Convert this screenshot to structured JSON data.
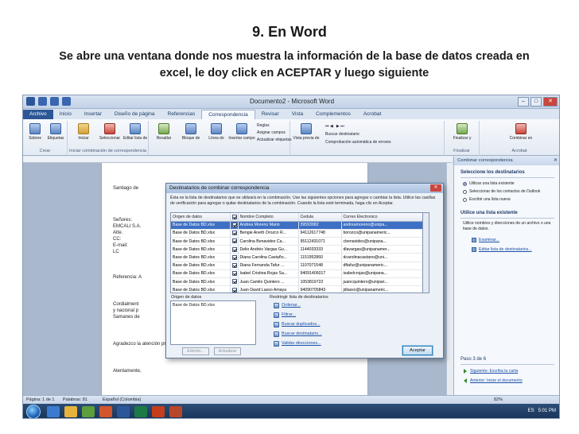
{
  "slide": {
    "title": "9. En Word",
    "subtitle": "Se abre una ventana donde nos muestra la información de la base de datos creada en excel, le doy click en ACEPTAR y luego siguiente"
  },
  "window": {
    "title": "Documento2 - Microsoft Word"
  },
  "tabs": [
    "Archivo",
    "Inicio",
    "Insertar",
    "Diseño de página",
    "Referencias",
    "Correspondencia",
    "Revisar",
    "Vista",
    "Complementos",
    "Acrobat"
  ],
  "active_tab": "Correspondencia",
  "ribbon": {
    "sobres": "Sobres",
    "etiquetas": "Etiquetas",
    "iniciar": "Iniciar combinación de correspondencia",
    "seleccionar": "Seleccionar destinatarios",
    "editar": "Editar lista de destinatarios",
    "resaltar": "Resaltar campos de combinación",
    "bloque": "Bloque de direcciones",
    "saludo": "Línea de saludo",
    "insertar_campo": "Insertar campo combinado",
    "reglas": "Reglas",
    "asignar": "Asignar campos",
    "actualizar": "Actualizar etiquetas",
    "vista_previa": "Vista previa de resultados",
    "buscar_dest": "Buscar destinatario",
    "comprobacion": "Comprobación automática de errores",
    "finalizar": "Finalizar y combinar",
    "combinar_pdf": "Combinar en archivo PDF de Adobe",
    "g_crear": "Crear",
    "g_iniciar": "Iniciar combinación de correspondencia",
    "g_finalizar": "Finalizar",
    "g_acrobat": "Acrobat"
  },
  "document": {
    "lines": [
      "Santiago de",
      "Señores:",
      "EMCALI S.A.",
      "Atte.",
      "CC:",
      "E-mail:",
      "LC",
      "Referencia: A",
      "Cordialment",
      "y nacional p",
      "Samanes de",
      "Agradezco la atención prestada.",
      "Atentamente,"
    ]
  },
  "dialog": {
    "title": "Destinatarios de combinar correspondencia",
    "description": "Ésta es la lista de destinatarios que se utilizará en la combinación. Use las siguientes opciones para agregar o cambiar la lista. Utilice las casillas de verificación para agregar o quitar destinatarios de la combinación. Cuando la lista esté terminada, haga clic en Aceptar.",
    "columns": [
      "Origen de datos",
      "",
      "Nombre Completo",
      "Cedula",
      "Correo Electronico"
    ],
    "rows": [
      [
        "Base de Datos BD.xlsx",
        "Andrea Moreno Mario",
        "39593982",
        "andreamoreno@unipa..."
      ],
      [
        "Base de Datos BD.xlsx",
        "Bengie Aneth Orozco R...",
        "94112617748",
        "borozco@unipanameric..."
      ],
      [
        "Base de Datos BD.xlsx",
        "Carolina Benavides Ca...",
        "95112431071",
        "cbenavides@unipana..."
      ],
      [
        "Base de Datos BD.xlsx",
        "Delio Andrés Vargas Gu...",
        "1144033333",
        "dlavargas@unipanamer..."
      ],
      [
        "Base de Datos BD.xlsx",
        "Diana Carolina Castaño...",
        "1151952860",
        "dcarolinacastano@uni..."
      ],
      [
        "Base de Datos BD.xlsx",
        "Diana Fernanda Tafur ...",
        "1107071548",
        "dftafur@unipanameric..."
      ],
      [
        "Base de Datos BD.xlsx",
        "Isabel Cristina Rojas Sa...",
        "94091406017",
        "isabelcrojas@unipana..."
      ],
      [
        "Base de Datos BD.xlsx",
        "Juan Camilo Quintero ...",
        "1053819722",
        "juancquintero@unipan..."
      ],
      [
        "Base de Datos BD.xlsx",
        "Juan David Lasso Amaya",
        "94090705843",
        "jdlasso@unipanameric..."
      ]
    ],
    "origen_label": "Origen de datos",
    "origen_item": "Base de Datos BD.xlsx",
    "restringir_label": "Restringir lista de destinatarios",
    "links": [
      "Ordenar...",
      "Filtrar...",
      "Buscar duplicados...",
      "Buscar destinatario...",
      "Validar direcciones..."
    ],
    "edit_btn": "Edición...",
    "update_btn": "Actualizar",
    "ok_btn": "Aceptar"
  },
  "pane": {
    "title": "Combinar correspondencia",
    "sec1": "Seleccione los destinatarios",
    "opt1": "Utilizar una lista existente",
    "opt2": "Seleccionar de los contactos de Outlook",
    "opt3": "Escribir una lista nueva",
    "sec2": "Utilice una lista existente",
    "desc": "Utilice nombres y direcciones de un archivo o una base de datos.",
    "link1": "Examinar...",
    "link2": "Editar lista de destinatarios...",
    "step": "Paso 3 de 6",
    "next": "Siguiente: Escriba la carta",
    "prev": "Anterior: Inicie el documento"
  },
  "status": {
    "page": "Página: 1 de 1",
    "words": "Palabras: 81",
    "lang": "Español (Colombia)",
    "zoom": "82%"
  },
  "taskbar": {
    "time": "5:01 PM",
    "lang": "ES"
  }
}
